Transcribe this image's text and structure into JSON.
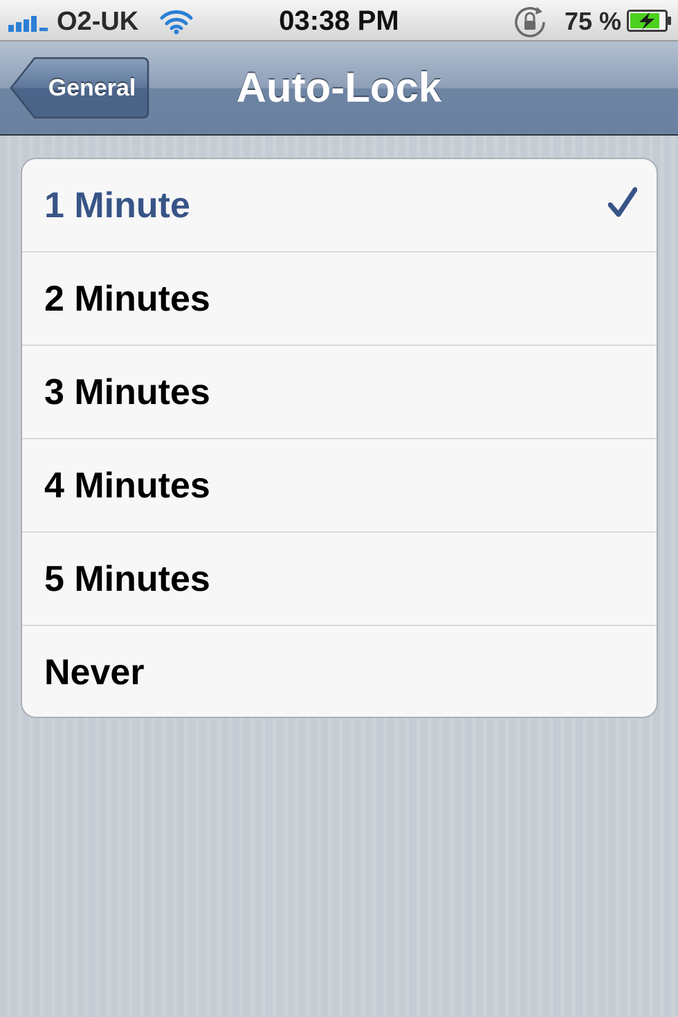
{
  "status_bar": {
    "carrier": "O2-UK",
    "time": "03:38 PM",
    "battery_percent": "75 %",
    "icons": {
      "signal": "signal-bars-icon",
      "wifi": "wifi-icon",
      "orientation_lock": "orientation-lock-icon",
      "battery": "battery-charging-icon"
    }
  },
  "nav_bar": {
    "back_label": "General",
    "title": "Auto-Lock"
  },
  "options": [
    {
      "label": "1 Minute",
      "selected": true
    },
    {
      "label": "2 Minutes",
      "selected": false
    },
    {
      "label": "3 Minutes",
      "selected": false
    },
    {
      "label": "4 Minutes",
      "selected": false
    },
    {
      "label": "5 Minutes",
      "selected": false
    },
    {
      "label": "Never",
      "selected": false
    }
  ],
  "colors": {
    "selected_text": "#385487",
    "nav_bar": "#6b81a0",
    "battery_fill": "#4cd11e"
  }
}
